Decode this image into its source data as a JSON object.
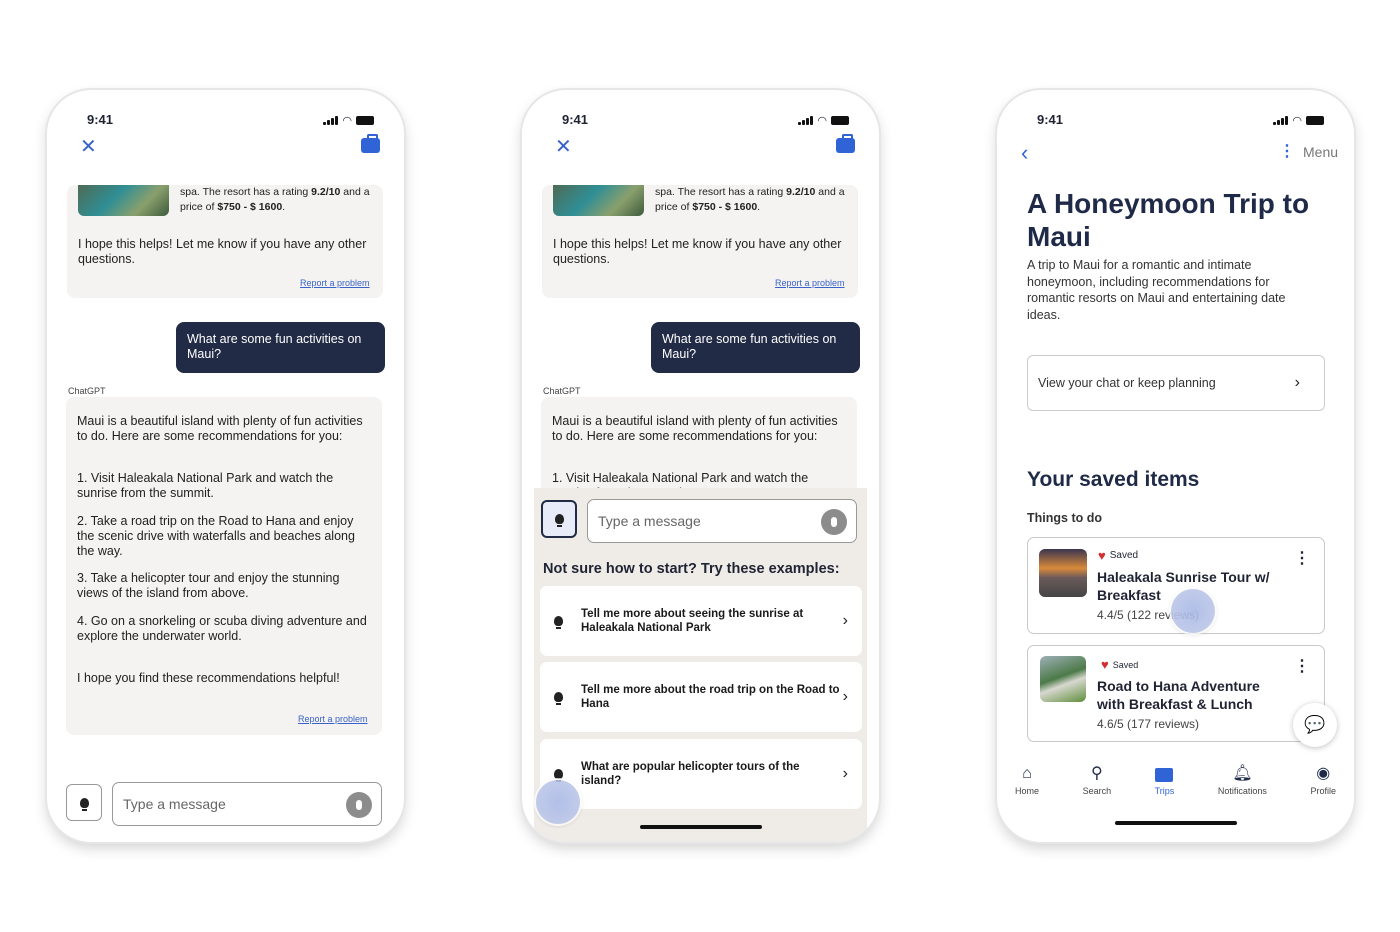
{
  "status_time": "9:41",
  "chat": {
    "resort_text_a": "spa. The resort has a rating ",
    "resort_rating": "9.2/10",
    "resort_text_b": " and a price of ",
    "resort_price": "$750 - $ 1600",
    "resort_text_c": ".",
    "closing_1": "I hope this helps! Let me know if you have any other questions.",
    "report": "Report a problem",
    "user_message": "What are some fun activities on Maui?",
    "sender": "ChatGPT",
    "answer_intro": "Maui is a beautiful island with plenty of fun activities to do. Here are some recommendations for you:",
    "answer_items": [
      "1. Visit Haleakala National Park and watch the sunrise from the summit.",
      "2. Take a road trip on the Road to Hana and enjoy the scenic drive with waterfalls and beaches along the way.",
      "3. Take a helicopter tour and enjoy the stunning views of the island from above.",
      "4. Go on a snorkeling or scuba diving adventure and explore the underwater world."
    ],
    "answer_closing": "I hope you find these recommendations helpful!",
    "input_placeholder": "Type a message",
    "suggest_heading": "Not sure how to start? Try these examples:",
    "suggestions": [
      "Tell me more about seeing the sunrise at Haleakala National Park",
      "Tell me more about the road trip on the Road to Hana",
      "What are popular helicopter tours of the island?"
    ]
  },
  "trip": {
    "menu": "Menu",
    "title": "A Honeymoon Trip to Maui",
    "description": "A trip to Maui for a romantic and intimate honeymoon, including recommendations for romantic resorts on Maui and entertaining date ideas.",
    "view_chat": "View your chat or keep planning",
    "saved_heading": "Your saved items",
    "section": "Things to do",
    "items": [
      {
        "badge": "Saved",
        "title": "Haleakala Sunrise Tour w/ Breakfast",
        "rating": "4.4/5 (122 reviews)"
      },
      {
        "badge": "Saved",
        "title": "Road to Hana Adventure with Breakfast & Lunch",
        "rating": "4.6/5 (177 reviews)"
      }
    ],
    "nav": [
      {
        "label": "Home",
        "icon": "home-icon"
      },
      {
        "label": "Search",
        "icon": "search-icon"
      },
      {
        "label": "Trips",
        "icon": "briefcase-icon",
        "active": true
      },
      {
        "label": "Notifications",
        "icon": "bell-icon"
      },
      {
        "label": "Profile",
        "icon": "profile-icon"
      }
    ]
  },
  "colors": {
    "accent": "#2f63d6",
    "user_bubble": "#222b45",
    "heart": "#d32f2f",
    "card_bg": "#f4f3f1"
  }
}
